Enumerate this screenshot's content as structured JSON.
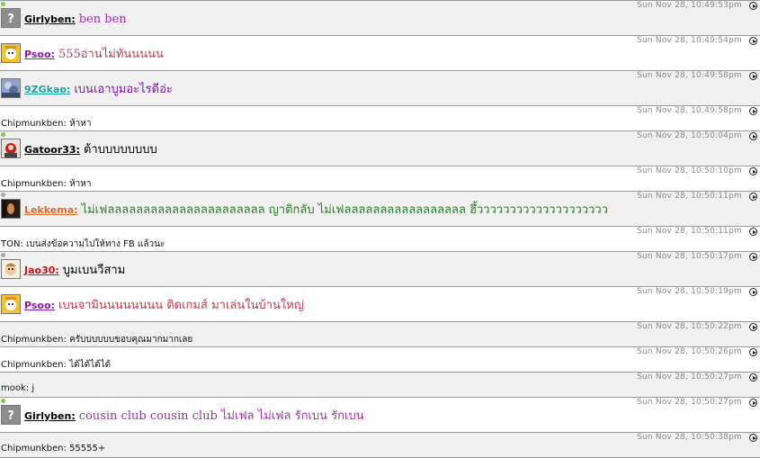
{
  "messages": [
    {
      "kind": "avatar",
      "user": "Girlyben:",
      "user_color": "#000000",
      "text": "ben ben",
      "text_color": "#a02fb0",
      "time": "Sun Nov 28, 10:49:53pm",
      "status": "online",
      "avatar": "question-mark-avatar-icon",
      "alt": true
    },
    {
      "kind": "avatar",
      "user": "Psoo:",
      "user_color": "#8b1aa6",
      "text": "555อ่านไม่ทันนนนน",
      "text_color": "#c23a50",
      "time": "Sun Nov 28, 10:49:54pm",
      "status": "none",
      "avatar": "yellow-cartoon-avatar-icon",
      "alt": false
    },
    {
      "kind": "avatar",
      "user": "9ZGkao:",
      "user_color": "#1aa6a0",
      "text": "เบนเอาบูมอะไรดีอ่ะ",
      "text_color": "#7a1aa6",
      "time": "Sun Nov 28, 10:49:58pm",
      "status": "none",
      "avatar": "blue-photo-avatar-icon",
      "alt": true
    },
    {
      "kind": "plain",
      "user": "Chipmunkben:",
      "text": "ห้าหา",
      "time": "Sun Nov 28, 10:49:58pm",
      "alt": false
    },
    {
      "kind": "avatar",
      "user": "Gatoor33:",
      "user_color": "#000000",
      "text": "ต้าบบบบบบบบ",
      "text_color": "#000000",
      "time": "Sun Nov 28, 10:50:04pm",
      "status": "online",
      "avatar": "red-character-avatar-icon",
      "alt": true
    },
    {
      "kind": "plain",
      "user": "Chipmunkben:",
      "text": "ห้าหา",
      "time": "Sun Nov 28, 10:50:10pm",
      "alt": false
    },
    {
      "kind": "avatar",
      "user": "Lekkema:",
      "user_color": "#e06a2c",
      "text": "ไม่เฟลลลลลลลลลลลลลลลลลลลลลล  ญาติกลับ ไม่เฟลลลลลลลลลลลลลลลลล  ฮึ้วววววววววววววววววววว",
      "text_color": "#2f7a2a",
      "time": "Sun Nov 28, 10:50:11pm",
      "status": "offline",
      "avatar": "dark-photo-avatar-icon",
      "alt": true
    },
    {
      "kind": "plain",
      "user": "TON:",
      "text": "เบนส่งข้อความไปให้ทาง FB แล้วนะ",
      "time": "Sun Nov 28, 10:50:11pm",
      "alt": false
    },
    {
      "kind": "avatar",
      "user": "Jao30:",
      "user_color": "#c81414",
      "text": "บูมเบนวีสาม",
      "text_color": "#000000",
      "time": "Sun Nov 28, 10:50:17pm",
      "status": "offline",
      "avatar": "cartoon-face-avatar-icon",
      "alt": true
    },
    {
      "kind": "avatar",
      "user": "Psoo:",
      "user_color": "#8b1aa6",
      "text": "เบนจามินนนนนนนน ติดเกมส์ มาเล่นในบ้านใหญ่",
      "text_color": "#c23a50",
      "time": "Sun Nov 28, 10:50:19pm",
      "status": "none",
      "avatar": "yellow-cartoon-avatar-icon",
      "alt": false
    },
    {
      "kind": "plain",
      "user": "Chipmunkben:",
      "text": "ครับบบบบบขอบคุณมากมากเลย",
      "time": "Sun Nov 28, 10:50:22pm",
      "alt": true
    },
    {
      "kind": "plain",
      "user": "Chipmunkben:",
      "text": "ได้ได้ได้ได้",
      "time": "Sun Nov 28, 10:50:26pm",
      "alt": false
    },
    {
      "kind": "plain",
      "user": "mook:",
      "text": "j",
      "time": "Sun Nov 28, 10:50:27pm",
      "alt": true
    },
    {
      "kind": "avatar",
      "user": "Girlyben:",
      "user_color": "#000000",
      "text": "cousin club cousin club ไม่เฟล ไม่เฟล รักเบน รักเบน",
      "text_color": "#a02fb0",
      "time": "Sun Nov 28, 10:50:27pm",
      "status": "online",
      "avatar": "question-mark-avatar-icon",
      "alt": false
    },
    {
      "kind": "plain",
      "user": "Chipmunkben:",
      "text": "55555+",
      "time": "Sun Nov 28, 10:50:38pm",
      "alt": true
    }
  ]
}
